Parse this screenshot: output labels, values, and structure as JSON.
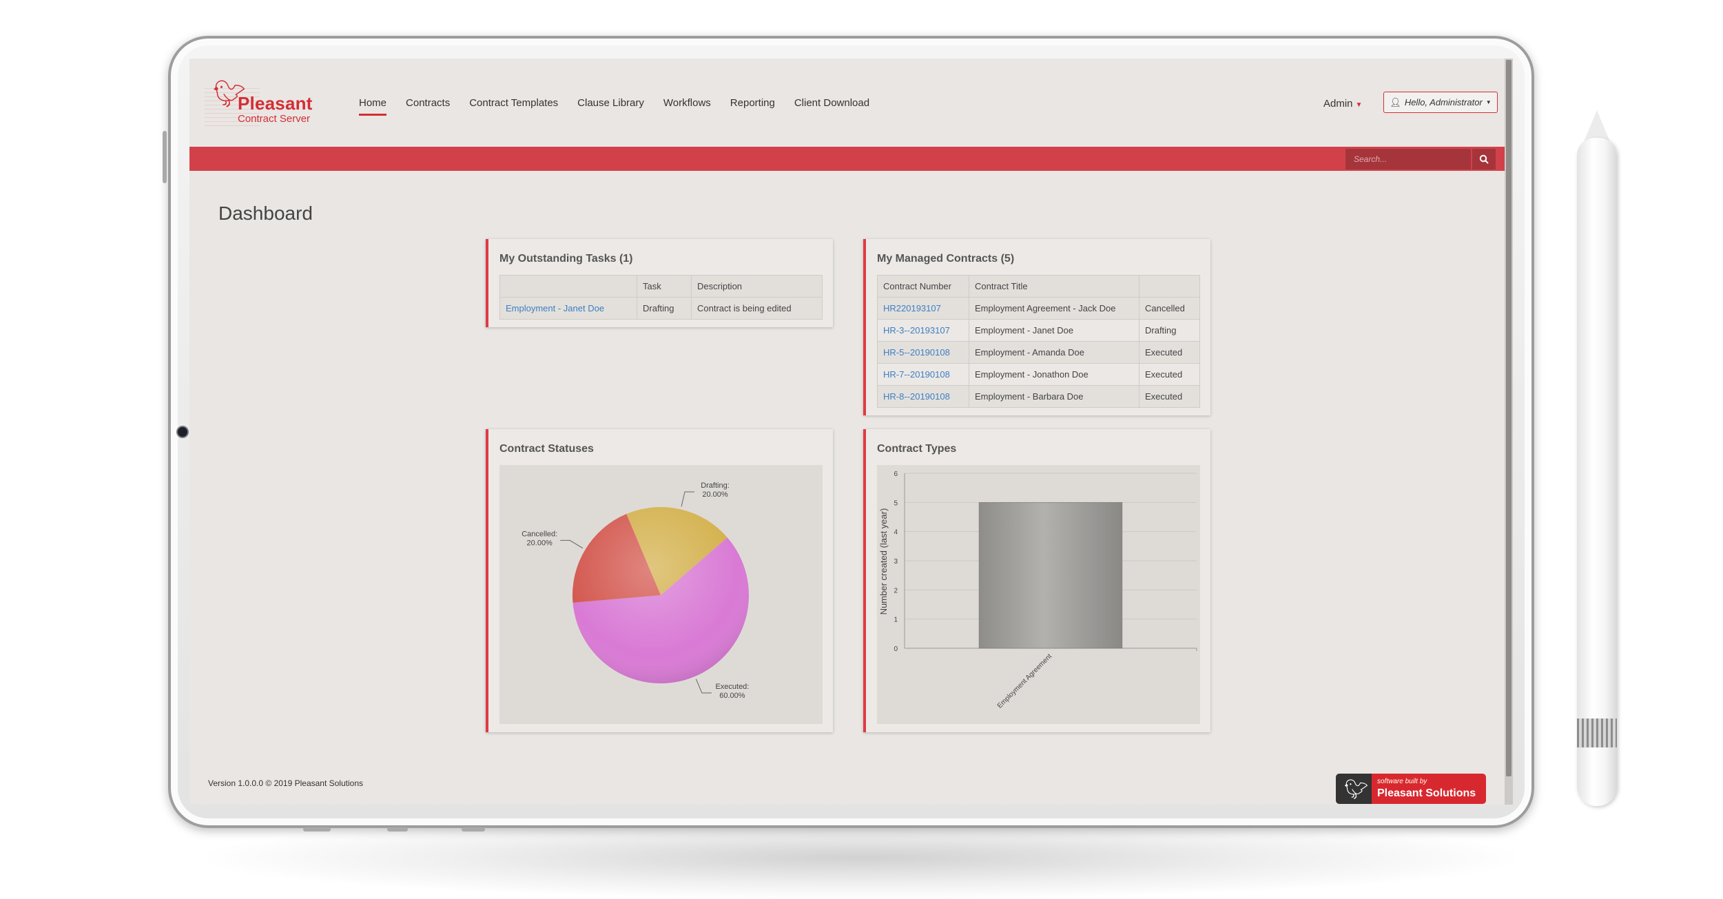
{
  "app": {
    "brand": "Pleasant",
    "product": "Contract Server"
  },
  "nav": {
    "items": [
      "Home",
      "Contracts",
      "Contract Templates",
      "Clause Library",
      "Workflows",
      "Reporting",
      "Client Download"
    ],
    "active": "Home"
  },
  "header": {
    "admin_label": "Admin",
    "user_greeting": "Hello, Administrator",
    "search_placeholder": "Search..."
  },
  "page": {
    "title": "Dashboard"
  },
  "tasks": {
    "title": "My Outstanding Tasks (1)",
    "columns": [
      "",
      "Task",
      "Description"
    ],
    "rows": [
      {
        "item": "Employment - Janet Doe",
        "task": "Drafting",
        "description": "Contract is being edited"
      }
    ]
  },
  "contracts": {
    "title": "My Managed Contracts (5)",
    "columns": [
      "Contract Number",
      "Contract Title",
      ""
    ],
    "rows": [
      {
        "number": "HR220193107",
        "title": "Employment Agreement - Jack Doe",
        "status": "Cancelled"
      },
      {
        "number": "HR-3--20193107",
        "title": "Employment - Janet Doe",
        "status": "Drafting"
      },
      {
        "number": "HR-5--20190108",
        "title": "Employment - Amanda Doe",
        "status": "Executed"
      },
      {
        "number": "HR-7--20190108",
        "title": "Employment - Jonathon Doe",
        "status": "Executed"
      },
      {
        "number": "HR-8--20190108",
        "title": "Employment - Barbara Doe",
        "status": "Executed"
      }
    ]
  },
  "chart_data": [
    {
      "type": "pie",
      "title": "Contract Statuses",
      "labels": [
        "Drafting",
        "Executed",
        "Cancelled"
      ],
      "values": [
        20.0,
        60.0,
        20.0
      ],
      "value_labels": [
        "Drafting:\n20.00%",
        "Executed:\n60.00%",
        "Cancelled:\n20.00%"
      ],
      "colors": [
        "#d4b14d",
        "#d97ad5",
        "#d3584f"
      ]
    },
    {
      "type": "bar",
      "title": "Contract Types",
      "categories": [
        "Employment Agreement"
      ],
      "values": [
        5
      ],
      "ylabel": "Number created (last year)",
      "ylim": [
        0,
        6
      ],
      "yticks": [
        0,
        1,
        2,
        3,
        4,
        5,
        6
      ],
      "grid": true,
      "color": "#a3a19e"
    }
  ],
  "footer": {
    "version": "Version 1.0.0.0 © 2019 Pleasant Solutions",
    "badge_small": "software built by",
    "badge_big": "Pleasant Solutions"
  }
}
